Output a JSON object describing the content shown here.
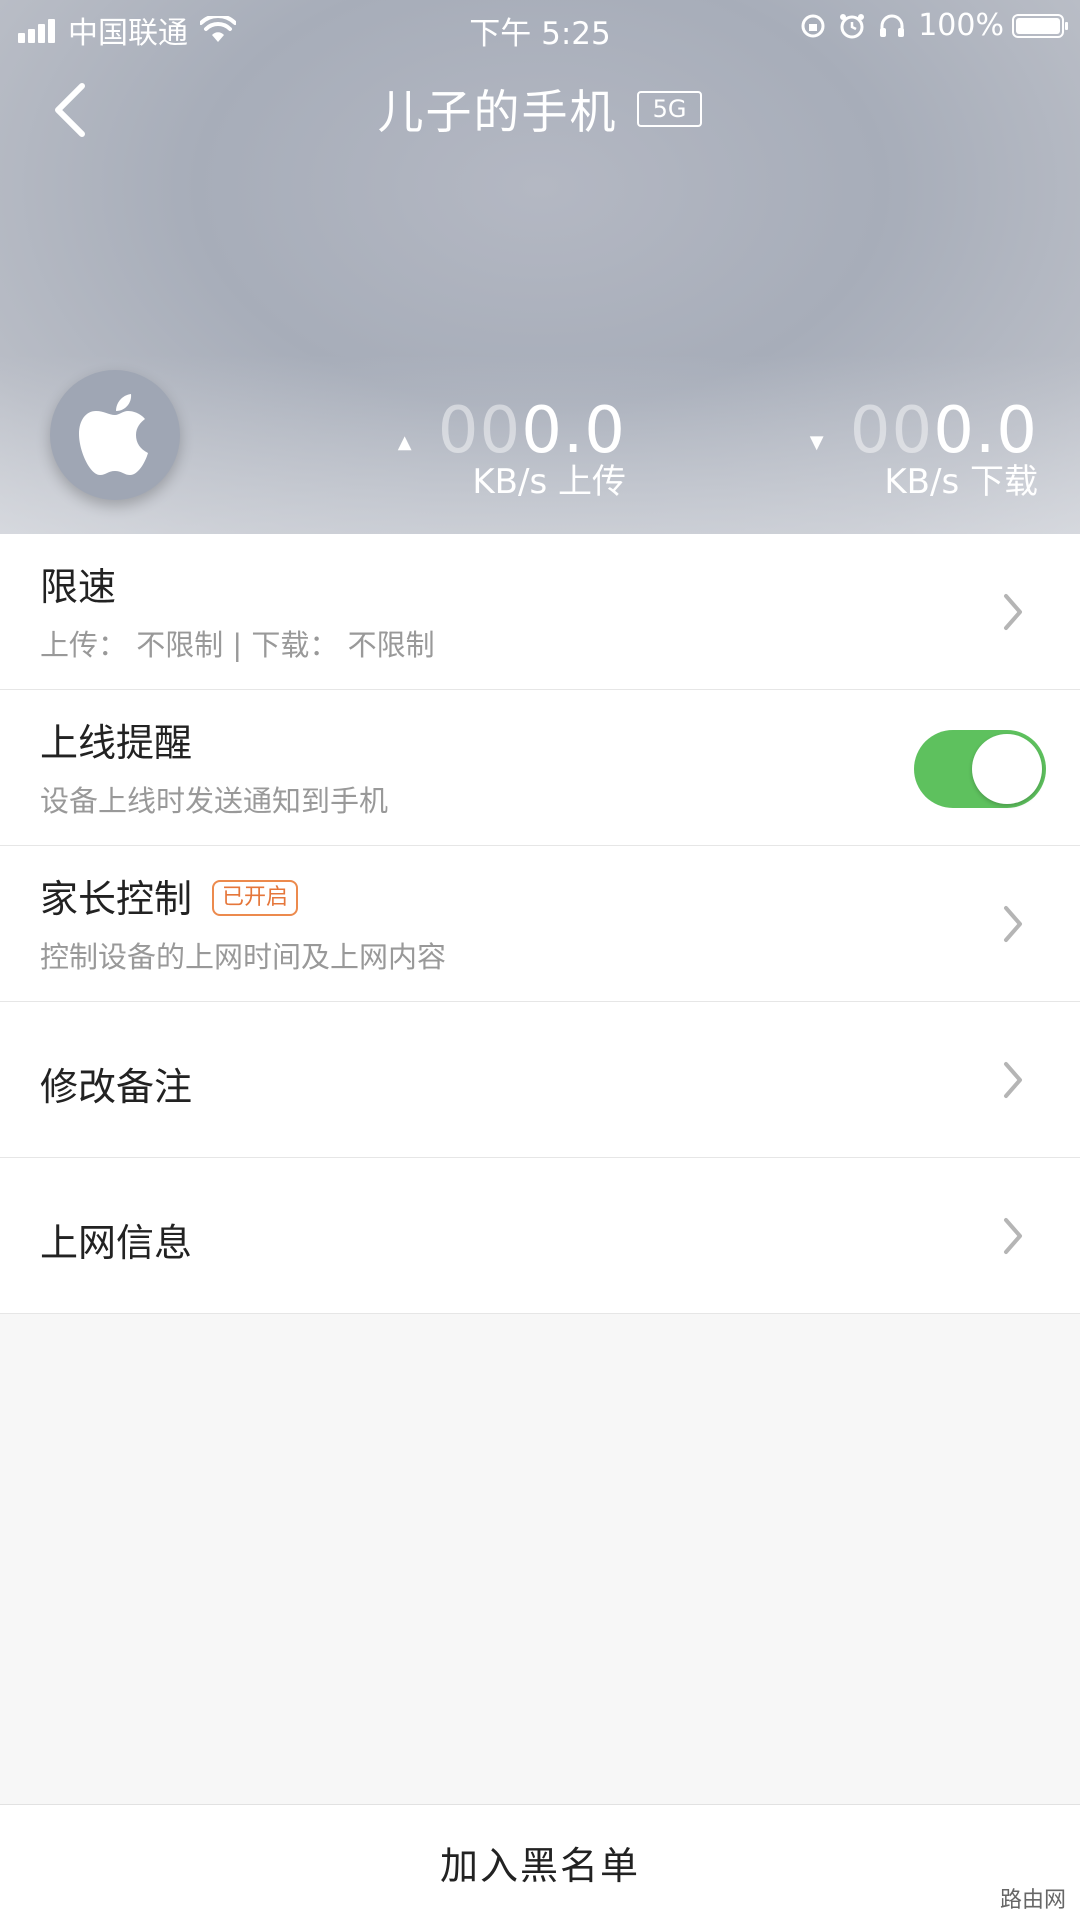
{
  "status_bar": {
    "carrier": "中国联通",
    "time": "下午 5:25",
    "battery": "100%"
  },
  "header": {
    "title": "儿子的手机",
    "band_badge": "5G",
    "upload": {
      "dim_digits": "00",
      "value": "0.0",
      "unit": "KB/s 上传"
    },
    "download": {
      "dim_digits": "00",
      "value": "0.0",
      "unit": "KB/s 下载"
    }
  },
  "settings": {
    "speed_limit": {
      "label": "限速",
      "subtitle": "上传：  不限制 | 下载：  不限制"
    },
    "online_alert": {
      "label": "上线提醒",
      "subtitle": "设备上线时发送通知到手机",
      "enabled": true
    },
    "parental_control": {
      "label": "家长控制",
      "tag": "已开启",
      "subtitle": "控制设备的上网时间及上网内容"
    },
    "edit_note": {
      "label": "修改备注"
    },
    "network_info": {
      "label": "上网信息"
    }
  },
  "footer": {
    "blacklist_label": "加入黑名单"
  },
  "watermark": "路由网",
  "colors": {
    "toggle_on": "#5ec15e",
    "tag": "#e5763a"
  }
}
